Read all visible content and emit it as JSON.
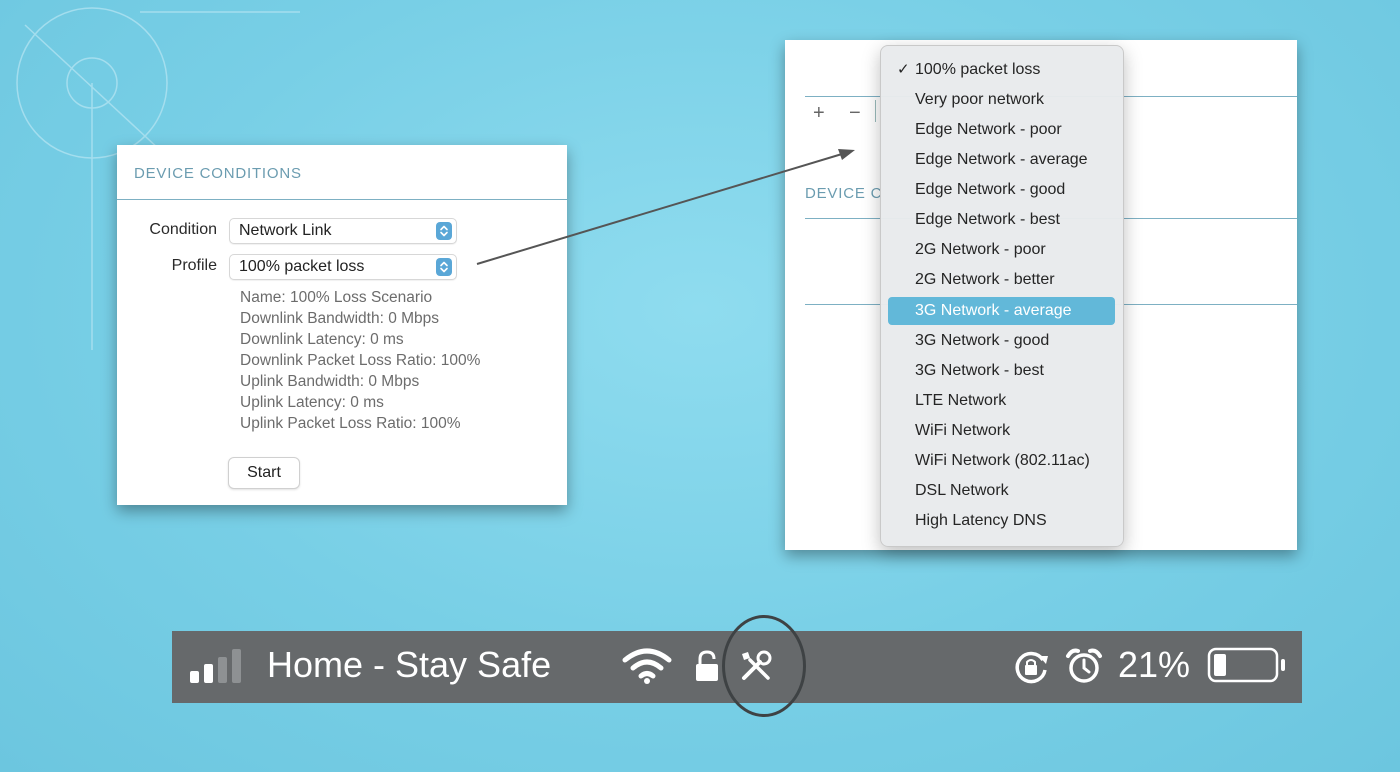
{
  "left_panel": {
    "section_title": "DEVICE CONDITIONS",
    "condition_label": "Condition",
    "condition_value": "Network Link",
    "profile_label": "Profile",
    "profile_value": "100% packet loss",
    "details": [
      "Name: 100% Loss Scenario",
      "Downlink Bandwidth: 0 Mbps",
      "Downlink Latency: 0 ms",
      "Downlink Packet Loss Ratio: 100%",
      "Uplink Bandwidth: 0 Mbps",
      "Uplink Latency: 0 ms",
      "Uplink Packet Loss Ratio: 100%"
    ],
    "start_button": "Start"
  },
  "right_panel": {
    "plus": "+",
    "minus": "−",
    "section_title_partial": "DEVICE C"
  },
  "dropdown": {
    "check_mark": "✓",
    "items": [
      "100% packet loss",
      "Very poor network",
      "Edge Network - poor",
      "Edge Network - average",
      "Edge Network - good",
      "Edge Network - best",
      "2G Network - poor",
      "2G Network - better",
      "3G Network - average",
      "3G Network - good",
      "3G Network - best",
      "LTE Network",
      "WiFi Network",
      "WiFi Network (802.11ac)",
      "DSL Network",
      "High Latency DNS"
    ],
    "checked_index": 0,
    "highlighted_index": 8
  },
  "status_bar": {
    "title": "Home - Stay Safe",
    "battery_percent": "21%",
    "battery_level": 0.21,
    "signal_bars_filled": 2,
    "signal_bars_total": 4,
    "icons": [
      "signal-icon",
      "wifi-icon",
      "lock-icon",
      "tools-icon",
      "rotation-lock-icon",
      "alarm-icon",
      "battery-icon"
    ]
  },
  "colors": {
    "accent": "#62b8d9",
    "section_title": "#6b9cb0",
    "status_bar": "#66696b",
    "background": "#7fd3ea"
  }
}
